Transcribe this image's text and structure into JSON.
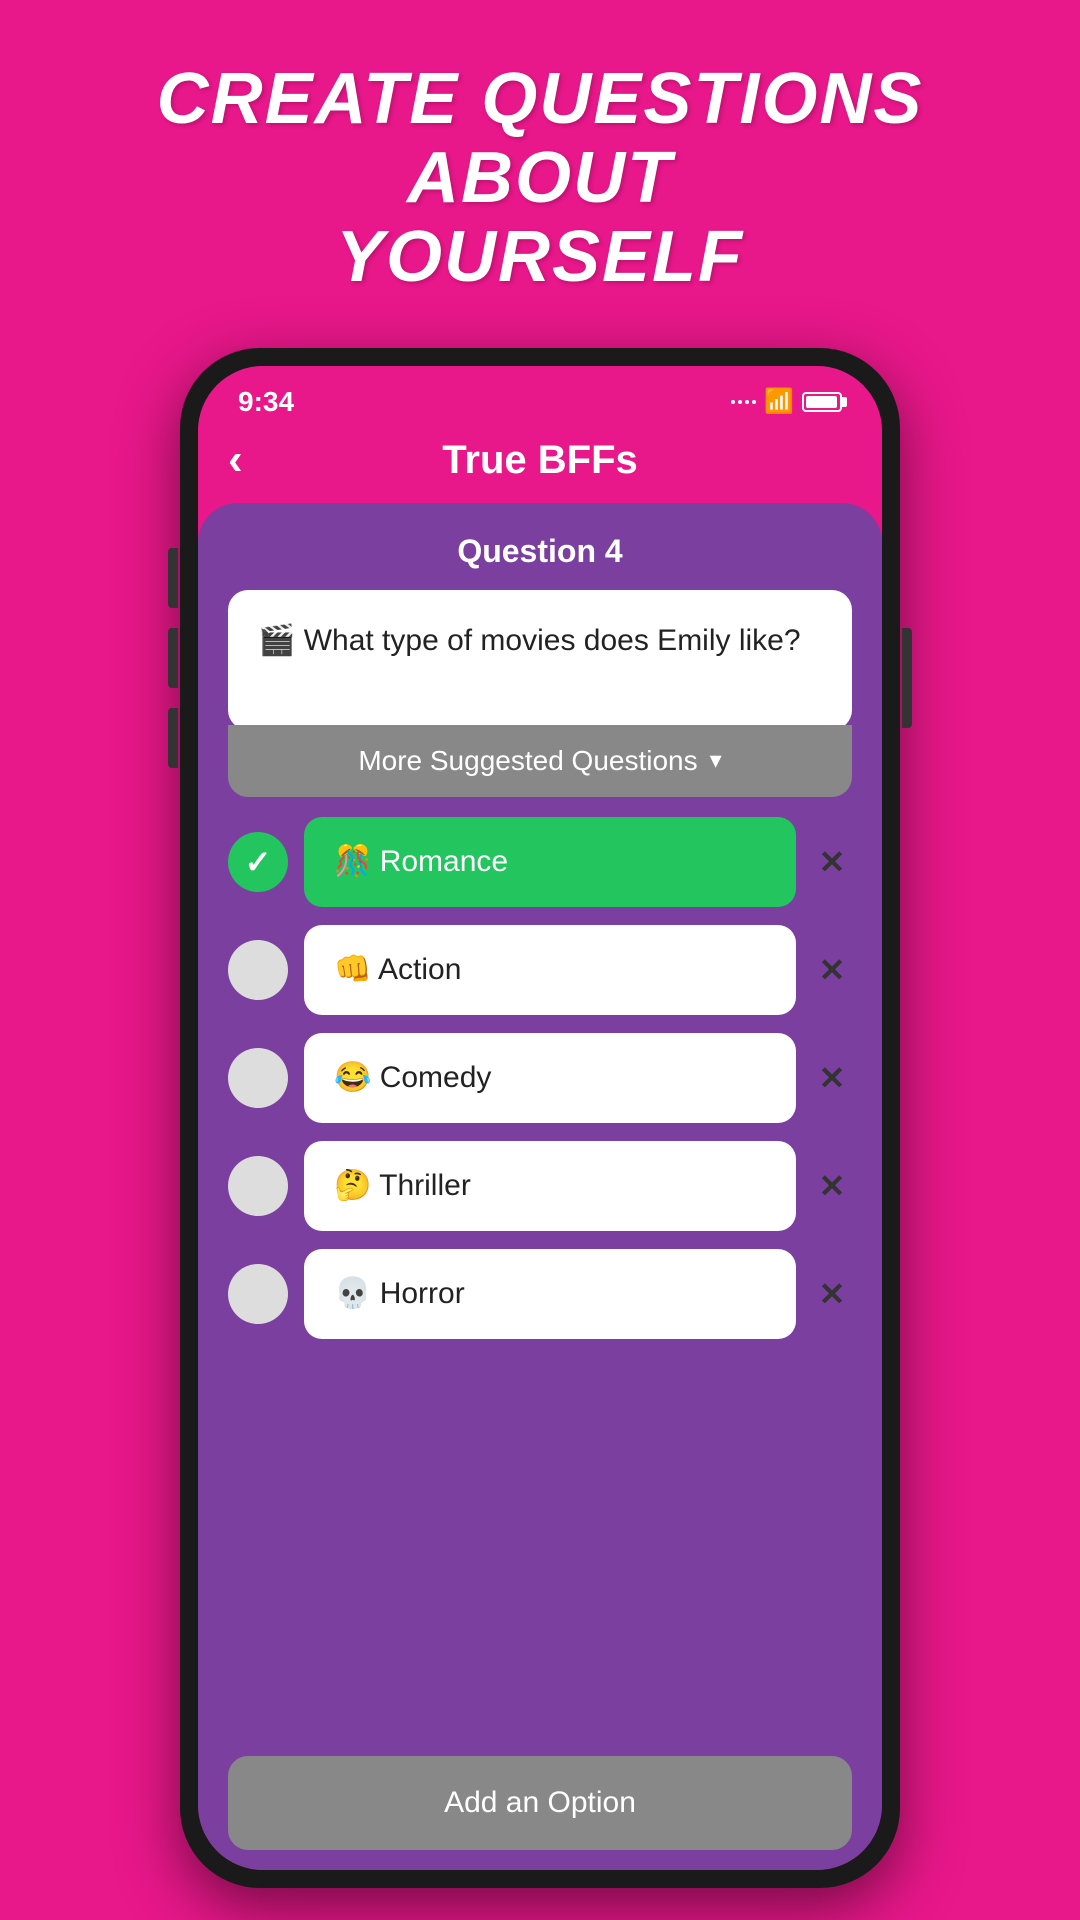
{
  "page": {
    "title": "CREATE QUESTIONS ABOUT\nYOURSELF"
  },
  "status_bar": {
    "time": "9:34"
  },
  "nav": {
    "back_label": "‹",
    "title": "True BFFs"
  },
  "question_section": {
    "label": "Question 4",
    "text": "🎬 What type of movies does Emily like?",
    "suggested_btn_label": "More Suggested Questions",
    "suggested_chevron": "▾"
  },
  "options": [
    {
      "emoji": "🎊",
      "label": "Romance",
      "selected": true
    },
    {
      "emoji": "👊",
      "label": "Action",
      "selected": false
    },
    {
      "emoji": "😂",
      "label": "Comedy",
      "selected": false
    },
    {
      "emoji": "🤔",
      "label": "Thriller",
      "selected": false
    },
    {
      "emoji": "💀",
      "label": "Horror",
      "selected": false
    }
  ],
  "add_option_label": "Add an Option"
}
